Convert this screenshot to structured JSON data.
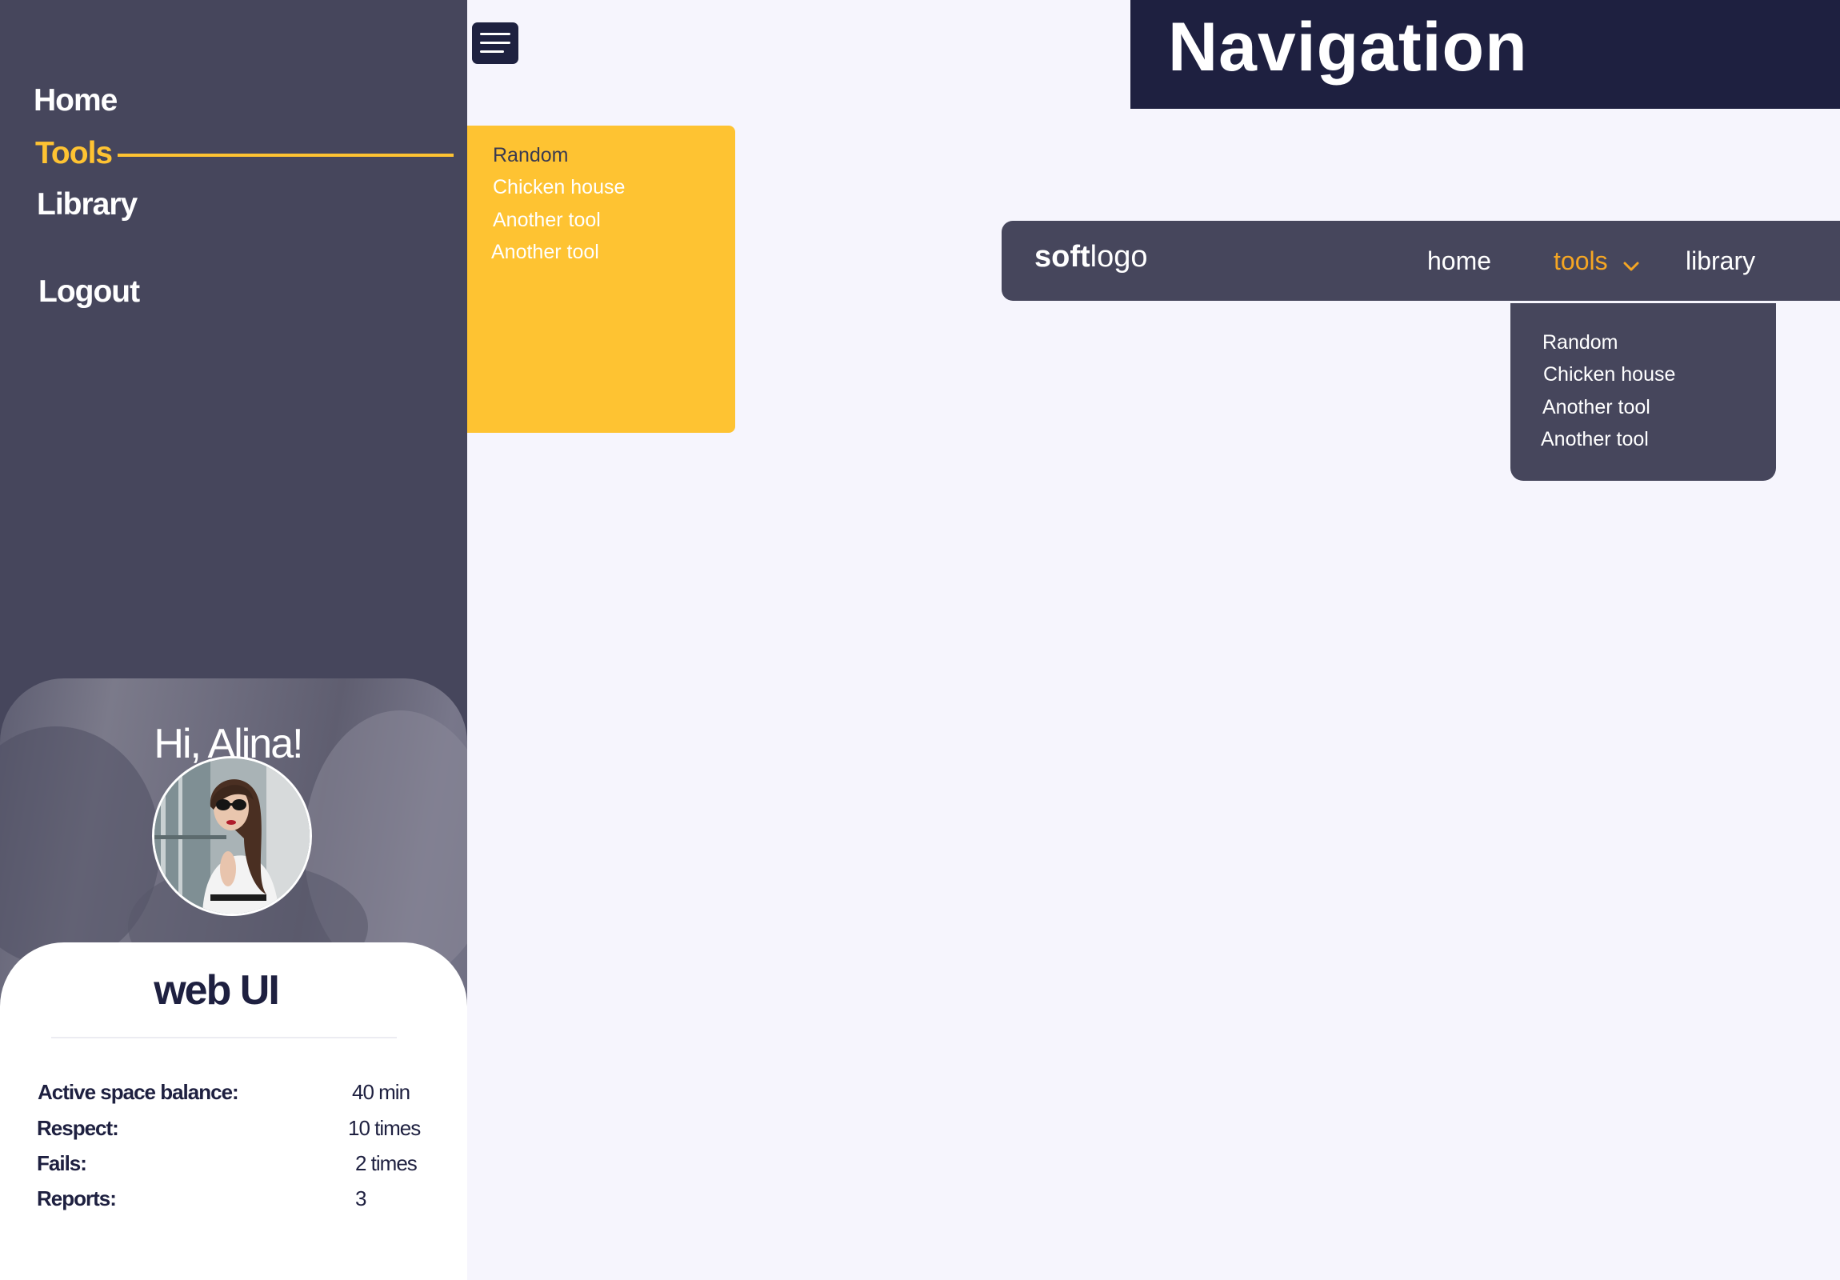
{
  "sidebar": {
    "items": [
      {
        "label": "Home",
        "active": false
      },
      {
        "label": "Tools",
        "active": true
      },
      {
        "label": "Library",
        "active": false
      },
      {
        "label": "Logout",
        "active": false
      }
    ]
  },
  "profile": {
    "greeting": "Hi, Alina!",
    "card_title": "web UI",
    "stats": [
      {
        "label": "Active space balance:",
        "value": "40 min"
      },
      {
        "label": "Respect:",
        "value": "10 times"
      },
      {
        "label": "Fails:",
        "value": "2 times"
      },
      {
        "label": "Reports:",
        "value": "3"
      }
    ]
  },
  "yellow_menu": {
    "items": [
      "Random",
      "Chicken house",
      "Another tool",
      "Another tool"
    ]
  },
  "page": {
    "title": "Navigation"
  },
  "navbar": {
    "logo_bold": "soft",
    "logo_light": "logo",
    "links": [
      {
        "label": "home",
        "active": false
      },
      {
        "label": "tools",
        "active": true,
        "icon": "chevron-down-icon"
      },
      {
        "label": "library",
        "active": false
      }
    ]
  },
  "dark_menu": {
    "items": [
      "Random",
      "Chicken house",
      "Another tool",
      "Another tool"
    ]
  },
  "colors": {
    "sidebar_bg": "#46465c",
    "accent_yellow": "#fec332",
    "accent_orange": "#f5a623",
    "dark_navy": "#1e2040",
    "page_bg": "#f6f5fd"
  }
}
